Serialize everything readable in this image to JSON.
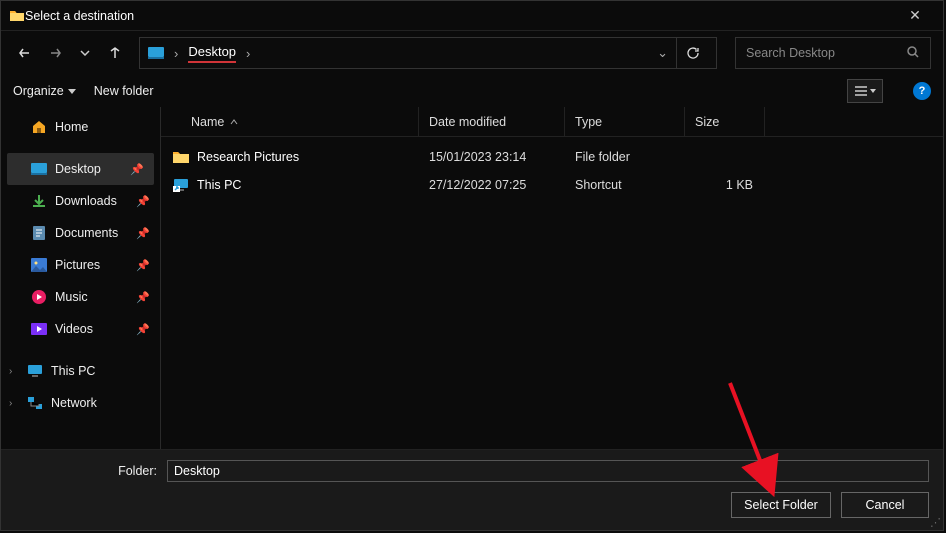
{
  "window": {
    "title": "Select a destination"
  },
  "breadcrumb": {
    "location": "Desktop"
  },
  "search": {
    "placeholder": "Search Desktop"
  },
  "toolbar": {
    "organize": "Organize",
    "new_folder": "New folder"
  },
  "sidebar": {
    "home": "Home",
    "desktop": "Desktop",
    "downloads": "Downloads",
    "documents": "Documents",
    "pictures": "Pictures",
    "music": "Music",
    "videos": "Videos",
    "this_pc": "This PC",
    "network": "Network"
  },
  "columns": {
    "name": "Name",
    "date": "Date modified",
    "type": "Type",
    "size": "Size"
  },
  "files": [
    {
      "name": "Research Pictures",
      "date": "15/01/2023 23:14",
      "type": "File folder",
      "size": ""
    },
    {
      "name": "This PC",
      "date": "27/12/2022 07:25",
      "type": "Shortcut",
      "size": "1 KB"
    }
  ],
  "footer": {
    "folder_label": "Folder:",
    "folder_value": "Desktop",
    "select": "Select Folder",
    "cancel": "Cancel"
  }
}
